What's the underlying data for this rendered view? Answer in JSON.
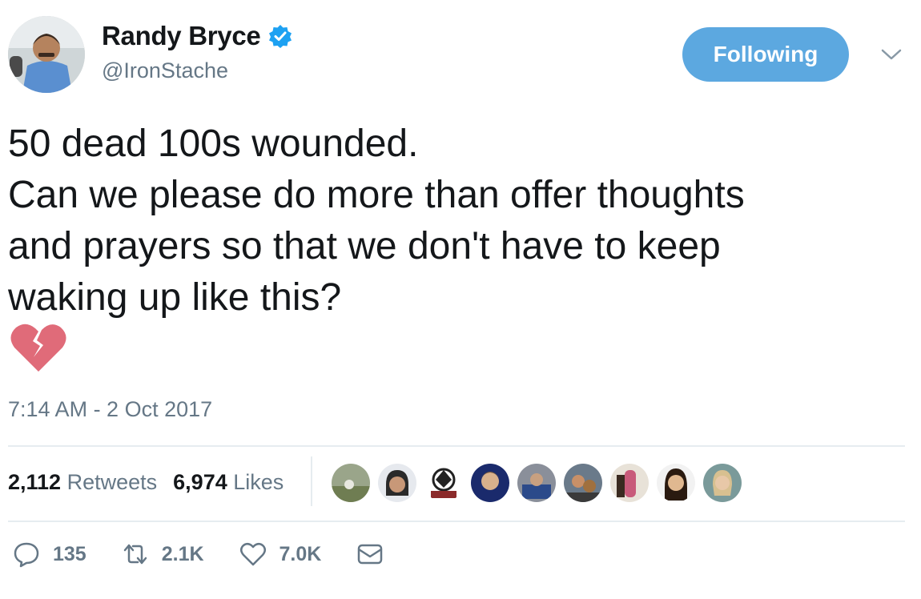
{
  "author": {
    "name": "Randy Bryce",
    "handle": "@IronStache",
    "verified": true
  },
  "follow_button": {
    "label": "Following",
    "color": "#5ca8e0"
  },
  "tweet": {
    "text": "50 dead 100s wounded.\nCan we please do more than offer thoughts\nand prayers so that we don't have to keep\nwaking up like this?",
    "emoji": "broken-heart",
    "timestamp": "7:14 AM - 2 Oct 2017"
  },
  "stats": {
    "retweets_count": "2,112",
    "retweets_label": "Retweets",
    "likes_count": "6,974",
    "likes_label": "Likes"
  },
  "liked_by_avatar_count": 9,
  "actions": {
    "replies": "135",
    "retweets": "2.1K",
    "likes": "7.0K"
  },
  "colors": {
    "accent": "#1da1f2",
    "text": "#14171a",
    "secondary": "#657786",
    "heart": "#e06b79"
  }
}
